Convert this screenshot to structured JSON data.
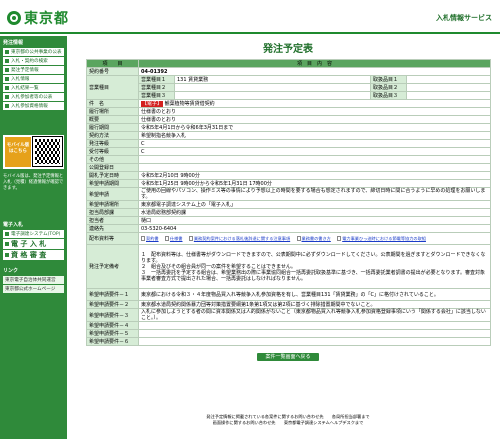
{
  "header": {
    "logo_text": "東京都",
    "service_name": "入札情報サービス"
  },
  "sidebar": {
    "section1_title": "発注情報",
    "items1": [
      "東京都の公共事業の公表",
      "入札・契約の検索",
      "発注予定情報",
      "入札情報",
      "入札結果一覧",
      "入札参加者等の公表",
      "入札参加資格情報"
    ],
    "mobile_label": "モバイル版はこちら",
    "note": "モバイル版は、発注予定情報と入札（見積）経過情報が確認できます。",
    "section2_title": "電子入札",
    "items2": [
      "電子調達システム(TOP)",
      "電 子 入 札",
      "資 格 審 査"
    ],
    "section3_title": "リンク",
    "items3": [
      "東京電子自治体共同運営",
      "東京都公式ホームページ"
    ]
  },
  "page": {
    "title": "発注予定表",
    "col_item": "項　　目",
    "col_content": "項　目　内　容"
  },
  "rows": {
    "contract_no": {
      "label": "契約番号",
      "value": "04-01392"
    },
    "business": {
      "label": "営業種目",
      "items": [
        {
          "name": "営業種目１",
          "value": "131 賃貸業務",
          "extra_label": "取扱品目１",
          "extra_value": ""
        },
        {
          "name": "営業種目２",
          "value": "",
          "extra_label": "取扱品目２",
          "extra_value": ""
        },
        {
          "name": "営業種目３",
          "value": "",
          "extra_label": "取扱品目３",
          "extra_value": ""
        }
      ]
    },
    "case_name": {
      "label": "件　名",
      "tag": "【電子】",
      "value": "観葉植物等賃貸借契約"
    },
    "location": {
      "label": "履行場所",
      "value": "仕様書のとおり"
    },
    "summary": {
      "label": "概要",
      "value": "仕様書のとおり"
    },
    "period": {
      "label": "履行期間",
      "value": "令和5年4月1日から令和6年3月31日まで"
    },
    "method": {
      "label": "契約方法",
      "value": "希望制指名競争入札"
    },
    "grade": {
      "label": "発注等級",
      "value": "C"
    },
    "accept_grade": {
      "label": "受付等級",
      "value": "C"
    },
    "other": {
      "label": "その他",
      "value": ""
    },
    "published": {
      "label": "公開登録日",
      "value": ""
    },
    "open_date": {
      "label": "開札予定日時",
      "value": "令和5年2月10日 9時00分"
    },
    "apply_period": {
      "label": "希望申請期間",
      "value": "令和5年1月25日 9時00分から令和5年1月31日 17時00分"
    },
    "apply_method": {
      "label": "希望申請",
      "value": "ご使用の回線やパソコン、操作ミス等の事情により予想以上の時間を要する場合も想定されますので、締切日時に間に合うように早めの処理をお願いします。"
    },
    "apply_place": {
      "label": "希望申請場所",
      "value": "東京都電子調達システム上の「電子入札」"
    },
    "dept": {
      "label": "担当局部課",
      "value": "水道局総務部契約課"
    },
    "person": {
      "label": "担当者",
      "value": "樋口"
    },
    "contact": {
      "label": "連絡先",
      "value": "03-5320-6404"
    },
    "attachments": {
      "label": "配布資料等",
      "files": [
        "契約書",
        "仕様書",
        "業務契約案件における落札後辞退に関する注意事項",
        "業務書の書き方",
        "電力事業ひっ迫時における節電等協力の取組"
      ]
    },
    "remarks": {
      "label": "発注予定備考",
      "lines": [
        "１　配布資料等は、仕様書等がダウンロードできますので、公表期間中に必ずダウンロードしてください。公表期間を過ぎますとダウンロードできなくなります。",
        "２　組合及びその組合員が同一の案件を希望することはできません。",
        "３　一括再委託を予定する組合は、希望業務出の際に事業協同組合一括再委託取扱基準に基づき、一括再委託業者調書の提出が必要となります。審査対象事業者審査方式で提出された場合、一括再委託はしなければなりません。"
      ]
    },
    "req1": {
      "label": "希望申請要件－１",
      "value": "東京都における令和３・４年度物品買入れ等競争入札参加資格を有し、営業種目131「賃貸業務」の「C」に格付けされていること。"
    },
    "req2": {
      "label": "希望申請要件－２",
      "value": "東京都水道局契約関係暴力団等対策措置要綱第1条第1項又は第2項に基づく排除措置期間中でないこと。"
    },
    "req3": {
      "label": "希望申請要件－３",
      "value": "入札に参加しようとする者の間に資本関係又は人的関係がないこと（東京都物品買入れ等競争入札参加資格登録事項にいう「関係する会社」に該当しないこと。）。"
    },
    "req4": {
      "label": "希望申請要件－４",
      "value": ""
    },
    "req5": {
      "label": "希望申請要件－５",
      "value": ""
    },
    "req6": {
      "label": "希望申請要件－６",
      "value": ""
    }
  },
  "back_button": "案件一覧画面へ戻る",
  "footer": {
    "line1": "発注予定情報に掲載されている各案件に関するお問い合わせ先　　各局所担当部署まで",
    "line2": "画面操作に関するお問い合わせ先　　東京都電子調達システムヘルプデスクまで"
  }
}
